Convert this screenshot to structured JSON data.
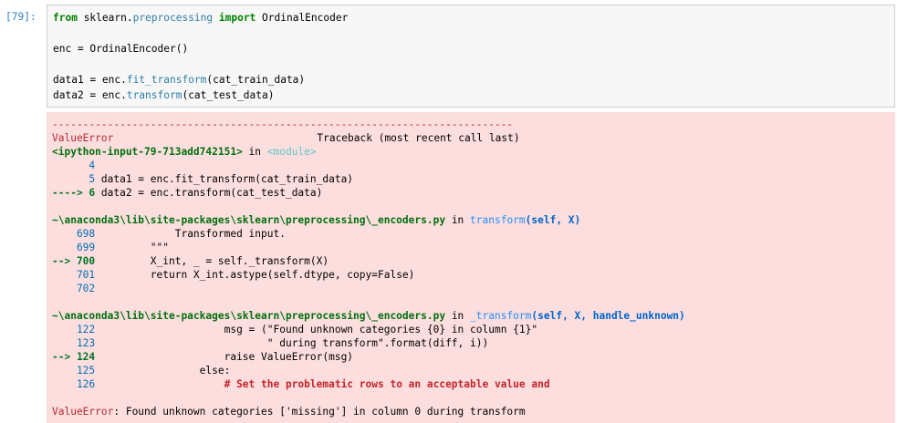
{
  "cell": {
    "prompt": "[79]:",
    "code": {
      "line1_kw1": "from",
      "line1_mod": " sklearn.",
      "line1_sub": "preprocessing",
      "line1_kw2": " import",
      "line1_cls": " OrdinalEncoder",
      "line2": "enc = OrdinalEncoder()",
      "line3_a": "data1 = enc.",
      "line3_fn": "fit_transform",
      "line3_b": "(cat_train_data)",
      "line4_a": "data2 = enc.",
      "line4_fn": "transform",
      "line4_b": "(cat_test_data)"
    }
  },
  "traceback": {
    "dashes": "---------------------------------------------------------------------------",
    "error_name": "ValueError",
    "header_right": "Traceback (most recent call last)",
    "input_ref": "<ipython-input-79-713add742151>",
    "in_word": " in ",
    "module": "<module>",
    "frame1": [
      {
        "arrow": "      4",
        "code": ""
      },
      {
        "arrow": "      5",
        "code": " data1 = enc.fit_transform(cat_train_data)"
      },
      {
        "arrow": "----> 6",
        "code": " data2 = enc.transform(cat_test_data)"
      }
    ],
    "file1": "~\\anaconda3\\lib\\site-packages\\sklearn\\preprocessing\\_encoders.py",
    "func1": "transform",
    "args1": "(self, X)",
    "frame2": [
      {
        "num": "    698",
        "code": "             Transformed input."
      },
      {
        "num": "    699",
        "code": "         \"\"\""
      },
      {
        "num": "--> 700",
        "code": "         X_int, _ = self._transform(X)"
      },
      {
        "num": "    701",
        "code": "         return X_int.astype(self.dtype, copy=False)"
      },
      {
        "num": "    702",
        "code": ""
      }
    ],
    "file2": "~\\anaconda3\\lib\\site-packages\\sklearn\\preprocessing\\_encoders.py",
    "func2": "_transform",
    "args2": "(self, X, handle_unknown)",
    "frame3": [
      {
        "num": "    122",
        "code": "                     msg = (\"Found unknown categories {0} in column {1}\""
      },
      {
        "num": "    123",
        "code": "                            \" during transform\".format(diff, i))"
      },
      {
        "num": "--> 124",
        "code": "                     raise ValueError(msg)"
      },
      {
        "num": "    125",
        "code": "                 else:"
      },
      {
        "num": "    126",
        "code": "                     # Set the problematic rows to an acceptable value and"
      }
    ],
    "final_name": "ValueError",
    "final_msg": ": Found unknown categories ['missing'] in column 0 during transform"
  }
}
